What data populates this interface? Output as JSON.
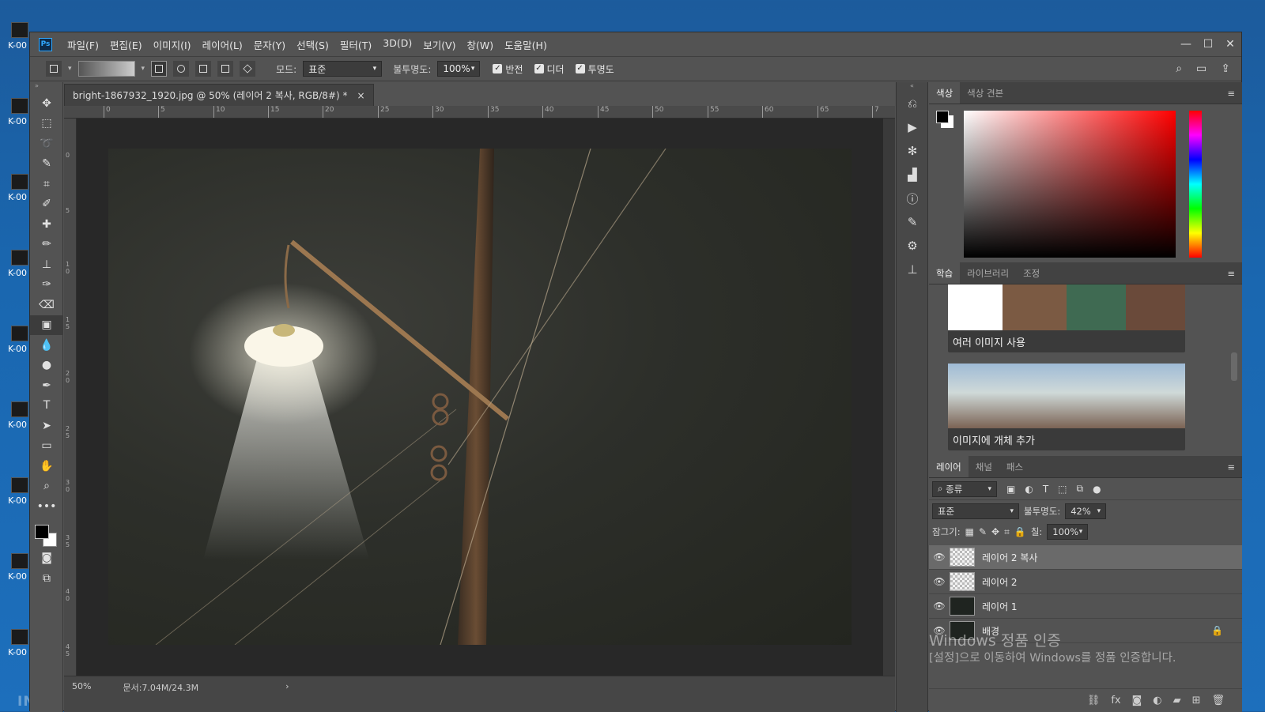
{
  "desktop": {
    "icons": [
      "K-00",
      "K-00",
      "K-00",
      "K-00",
      "K-00",
      "K-00",
      "K-00",
      "K-00",
      "K-00"
    ],
    "taskbar_logo": "INVAIZ"
  },
  "titlebar": {
    "app_icon": "Ps",
    "menu": [
      "파일(F)",
      "편집(E)",
      "이미지(I)",
      "레이어(L)",
      "문자(Y)",
      "선택(S)",
      "필터(T)",
      "3D(D)",
      "보기(V)",
      "창(W)",
      "도움말(H)"
    ],
    "minimize": "—",
    "maximize": "☐",
    "close": "✕"
  },
  "options": {
    "mode_label": "모드:",
    "mode_value": "표준",
    "opacity_label": "불투명도:",
    "opacity_value": "100%",
    "reverse_label": "반전",
    "dither_label": "디더",
    "transparency_label": "투명도"
  },
  "document": {
    "tab_title": "bright-1867932_1920.jpg @ 50% (레이어 2 복사, RGB/8#) *",
    "tab_close": "×",
    "ruler_h": [
      "0",
      "5",
      "10",
      "15",
      "20",
      "25",
      "30",
      "35",
      "40",
      "45",
      "50",
      "55",
      "60",
      "65",
      "7"
    ],
    "ruler_v": [
      "0",
      "5",
      "1 0",
      "1 5",
      "2 0",
      "2 5",
      "3 0",
      "3 5",
      "4 0",
      "4 5"
    ],
    "zoom": "50%",
    "doc_info": "문서:7.04M/24.3M",
    "status_arrow": "›"
  },
  "color_panel": {
    "tabs": [
      "색상",
      "색상 견본"
    ],
    "active_tab": "색상",
    "accent_colors": {
      "foreground": "#000000",
      "background": "#ffffff"
    }
  },
  "learn_panel": {
    "tabs": [
      "학습",
      "라이브러리",
      "조정"
    ],
    "active_tab": "학습",
    "cards": [
      {
        "title": "여러 이미지 사용"
      },
      {
        "title": "이미지에 개체 추가"
      }
    ]
  },
  "layers_panel": {
    "tabs": [
      "레이어",
      "채널",
      "패스"
    ],
    "active_tab": "레이어",
    "filter_label": "종류",
    "blend_mode": "표준",
    "opacity_label": "불투명도:",
    "opacity_value": "42%",
    "lock_label": "잠그기:",
    "fill_label": "칠:",
    "fill_value": "100%",
    "layers": [
      {
        "name": "레이어 2 복사",
        "selected": true,
        "thumb": "transparent"
      },
      {
        "name": "레이어 2",
        "selected": false,
        "thumb": "transparent"
      },
      {
        "name": "레이어 1",
        "selected": false,
        "thumb": "dark"
      },
      {
        "name": "배경",
        "selected": false,
        "thumb": "dark"
      }
    ]
  },
  "watermark": {
    "line1": "Windows 정품 인증",
    "line2": "[설정]으로 이동하여 Windows를 정품 인증합니다."
  }
}
